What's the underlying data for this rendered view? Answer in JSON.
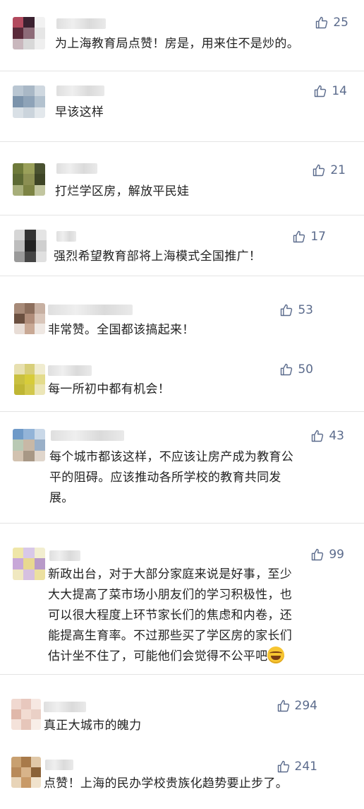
{
  "comments": [
    {
      "text": "为上海教育局点赞！房是，用来住不是炒的。",
      "likes": "25",
      "avatar": [
        "#b24a5e",
        "#3b2130",
        "#f2f2f2",
        "#5a2a3a",
        "#8d6b78",
        "#e6e6e6",
        "#c9b7bd",
        "#d8d8d8",
        "#efefef"
      ]
    },
    {
      "text": "早该这样",
      "likes": "14",
      "avatar": [
        "#b9c6d2",
        "#a9b8c6",
        "#cfd8e0",
        "#7b93ab",
        "#8ea3b8",
        "#b3c2cf",
        "#d9e0e6",
        "#cbd4dc",
        "#e3e8ec"
      ]
    },
    {
      "text": "打烂学区房，解放平民娃",
      "likes": "21",
      "avatar": [
        "#6e7a3a",
        "#9aa05a",
        "#4a5230",
        "#5d6a34",
        "#8b8f52",
        "#3e4526",
        "#a7ae7a",
        "#7d8444",
        "#c2c6a0"
      ]
    },
    {
      "text": "强烈希望教育部将上海模式全国推广！",
      "likes": "17",
      "avatar": [
        "#d6d6d6",
        "#333333",
        "#e4e4e4",
        "#bdbdbd",
        "#222222",
        "#cfcfcf",
        "#9a9a9a",
        "#444444",
        "#e0e0e0"
      ]
    },
    {
      "text": "非常赞。全国都该搞起来！",
      "likes": "53",
      "avatar": [
        "#a78a78",
        "#8c6e5c",
        "#c7b0a2",
        "#6b5040",
        "#b08d7a",
        "#d9c6ba",
        "#e8ddd6",
        "#c9a995",
        "#efe8e3"
      ]
    },
    {
      "text": "每一所初中都有机会！",
      "likes": "50",
      "avatar": [
        "#e7e0b0",
        "#d8cf7a",
        "#f0ecd0",
        "#c9c040",
        "#d7cc3a",
        "#e4dc8c",
        "#bfb634",
        "#d2c84c",
        "#ece6b8"
      ]
    },
    {
      "text": "每个城市都该这样，不应该让房产成为教育公\n平的阻碍。应该推动各所学校的教育共同发\n展。",
      "likes": "43",
      "avatar": [
        "#6f9ac8",
        "#93b4d8",
        "#c9d8e8",
        "#b9c9b4",
        "#c8b8a6",
        "#9ab0c8",
        "#d2c2b0",
        "#a89886",
        "#e0d6cc"
      ]
    },
    {
      "text": "新政出台，对于大部分家庭来说是好事，至少\n大大提高了菜市场小朋友们的学习积极性，也\n可以很大程度上环节家长们的焦虑和内卷，还\n能提高生育率。不过那些买了学区房的家长们\n估计坐不住了，可能他们会觉得不公平吧",
      "likes": "99",
      "avatar": [
        "#efe6a8",
        "#d8c8e8",
        "#f2eed0",
        "#c8a8d8",
        "#e8d890",
        "#b89ac8",
        "#f0e8c0",
        "#d6c0e0",
        "#ece0a0"
      ]
    },
    {
      "text": "真正大城市的魄力",
      "likes": "294",
      "avatar": [
        "#f0d8d0",
        "#e8c8be",
        "#f6e8e2",
        "#e0b8aa",
        "#f2dcd2",
        "#ead0c6",
        "#f4e2da",
        "#e6c6ba",
        "#f8eee8"
      ]
    },
    {
      "text": "点赞！上海的民办学校贵族化趋势要止步了。",
      "likes": "241",
      "avatar": [
        "#c8a070",
        "#a87a4a",
        "#e0c8a8",
        "#b88a5a",
        "#d8b48a",
        "#8a6238",
        "#e8d4b8",
        "#c89a68",
        "#f0e2cc"
      ]
    }
  ],
  "icons": {
    "like": "thumbs-up-icon",
    "emoji": "tears-of-joy-emoji"
  },
  "colors": {
    "like": "#5b6b8c",
    "text": "#222222",
    "divider": "#e4e4e4"
  }
}
